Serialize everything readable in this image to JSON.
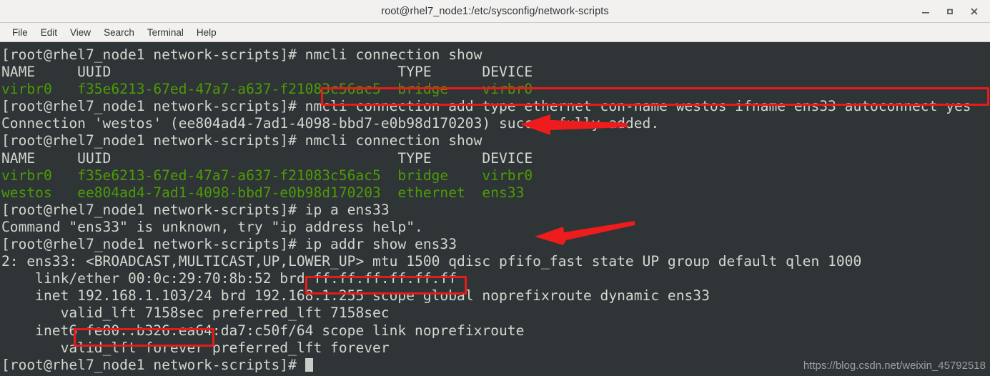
{
  "window": {
    "title": "root@rhel7_node1:/etc/sysconfig/network-scripts",
    "controls": {
      "minimize": "minimize",
      "maximize": "maximize",
      "close": "close"
    }
  },
  "menubar": {
    "items": [
      {
        "label": "File"
      },
      {
        "label": "Edit"
      },
      {
        "label": "View"
      },
      {
        "label": "Search"
      },
      {
        "label": "Terminal"
      },
      {
        "label": "Help"
      }
    ]
  },
  "terminal": {
    "prompt": "[root@rhel7_node1 network-scripts]#",
    "lines": [
      {
        "text": "[root@rhel7_node1 network-scripts]# nmcli connection show",
        "color": "#d3d7cf"
      },
      {
        "text": "NAME     UUID                                  TYPE      DEVICE",
        "color": "#d3d7cf"
      },
      {
        "text": "virbr0   f35e6213-67ed-47a7-a637-f21083c56ac5  bridge    virbr0",
        "color": "#4e9a06"
      },
      {
        "text": "[root@rhel7_node1 network-scripts]# nmcli connection add type ethernet con-name westos ifname ens33 autoconnect yes",
        "color": "#d3d7cf"
      },
      {
        "text": "Connection 'westos' (ee804ad4-7ad1-4098-bbd7-e0b98d170203) successfully added.",
        "color": "#d3d7cf"
      },
      {
        "text": "[root@rhel7_node1 network-scripts]# nmcli connection show",
        "color": "#d3d7cf"
      },
      {
        "text": "NAME     UUID                                  TYPE      DEVICE",
        "color": "#d3d7cf"
      },
      {
        "text": "virbr0   f35e6213-67ed-47a7-a637-f21083c56ac5  bridge    virbr0",
        "color": "#4e9a06"
      },
      {
        "text": "westos   ee804ad4-7ad1-4098-bbd7-e0b98d170203  ethernet  ens33",
        "color": "#4e9a06"
      },
      {
        "text": "[root@rhel7_node1 network-scripts]# ip a ens33",
        "color": "#d3d7cf"
      },
      {
        "text": "Command \"ens33\" is unknown, try \"ip address help\".",
        "color": "#d3d7cf"
      },
      {
        "text": "[root@rhel7_node1 network-scripts]# ip addr show ens33",
        "color": "#d3d7cf"
      },
      {
        "text": "2: ens33: <BROADCAST,MULTICAST,UP,LOWER_UP> mtu 1500 qdisc pfifo_fast state UP group default qlen 1000",
        "color": "#d3d7cf"
      },
      {
        "text": "    link/ether 00:0c:29:70:8b:52 brd ff:ff:ff:ff:ff:ff",
        "color": "#d3d7cf"
      },
      {
        "text": "    inet 192.168.1.103/24 brd 192.168.1.255 scope global noprefixroute dynamic ens33",
        "color": "#d3d7cf"
      },
      {
        "text": "       valid_lft 7158sec preferred_lft 7158sec",
        "color": "#d3d7cf"
      },
      {
        "text": "    inet6 fe80::b326:ea64:da7:c50f/64 scope link noprefixroute",
        "color": "#d3d7cf"
      },
      {
        "text": "       valid_lft forever preferred_lft forever",
        "color": "#d3d7cf"
      },
      {
        "text": "[root@rhel7_node1 network-scripts]# ",
        "color": "#d3d7cf"
      }
    ]
  },
  "annotations": {
    "color": "#e81a1a",
    "boxes": [
      {
        "name": "nmcli-add-command-highlight",
        "label": "nmcli connection add type ethernet con-name westos ifname ens33 autoconnect yes"
      },
      {
        "name": "ip-addr-show-command-highlight",
        "label": "ip addr show ens33"
      },
      {
        "name": "ip-address-highlight",
        "label": "192.168.1.103/24"
      }
    ],
    "arrows": [
      {
        "name": "arrow-virbr0-device",
        "points_to": "virbr0"
      },
      {
        "name": "arrow-ens33-device",
        "points_to": "ens33"
      }
    ]
  },
  "watermark": {
    "text": "https://blog.csdn.net/weixin_45792518"
  }
}
